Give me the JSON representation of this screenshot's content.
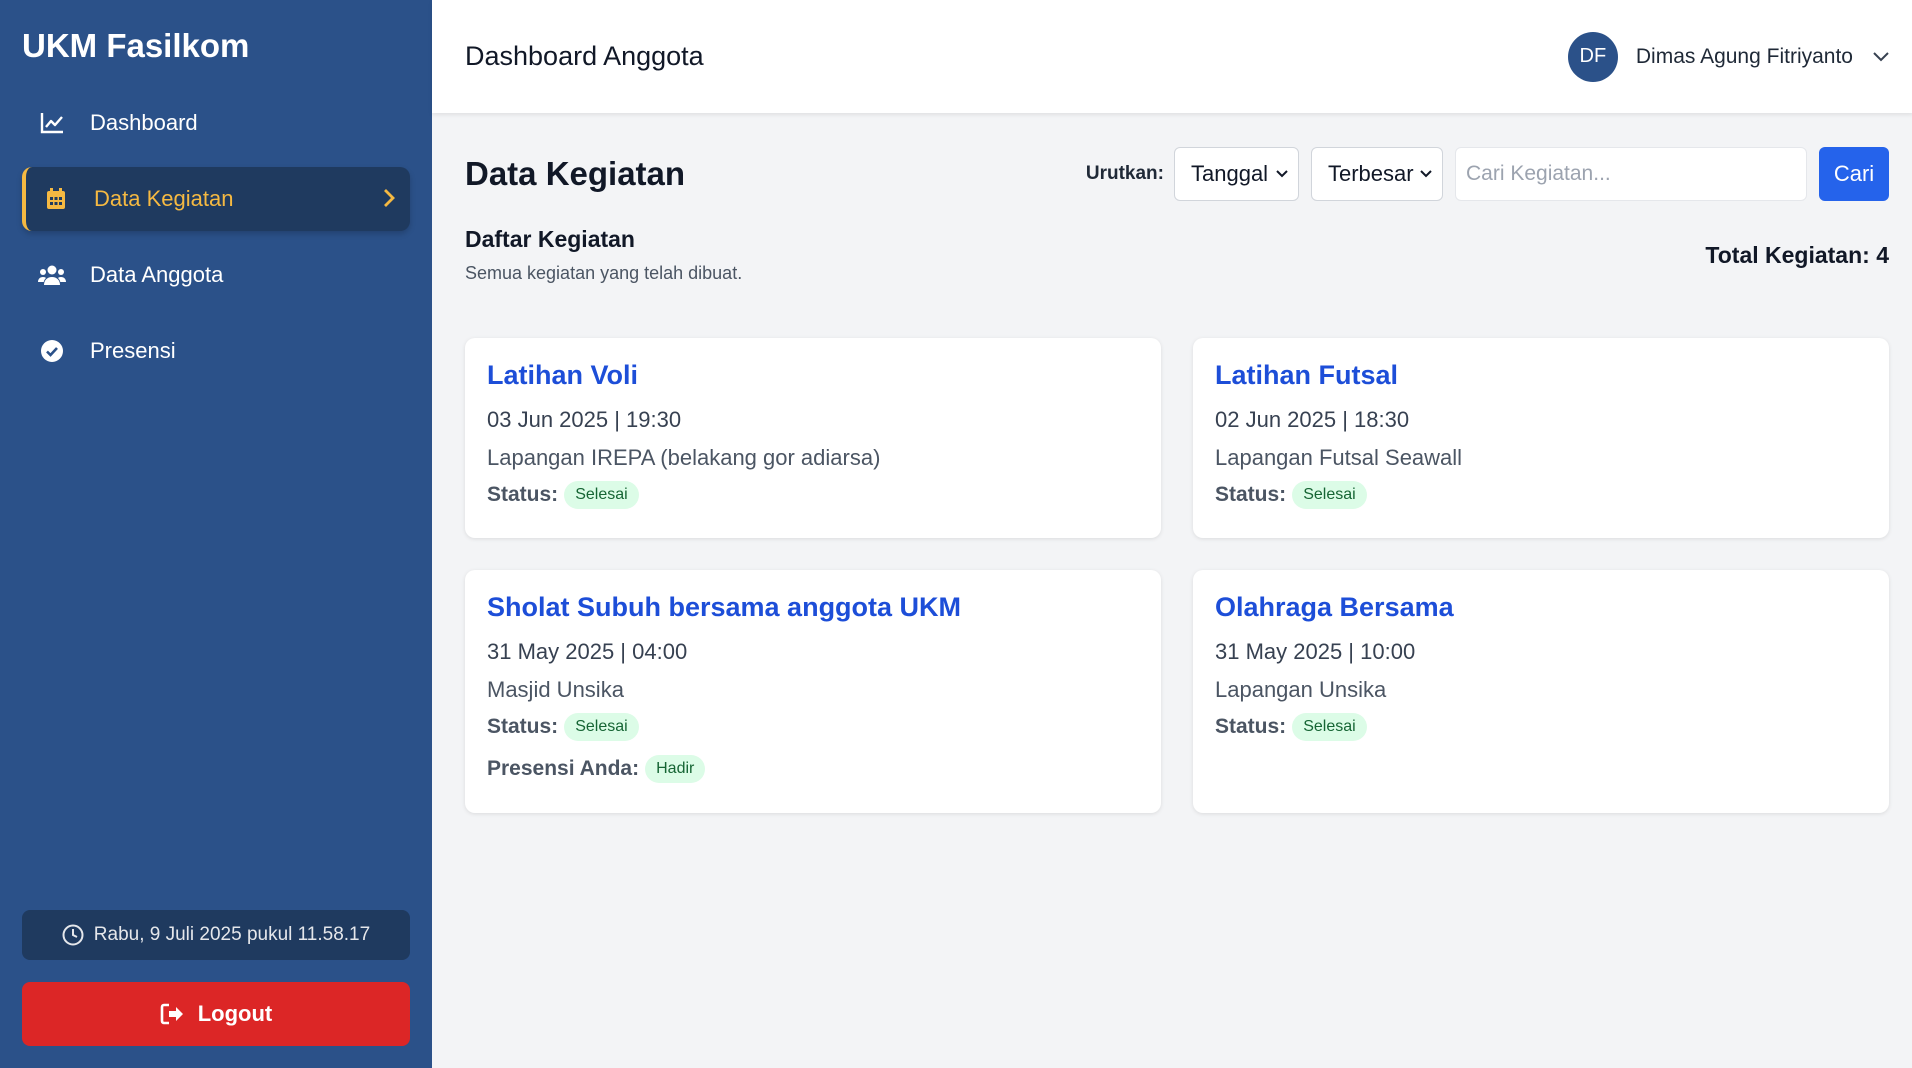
{
  "sidebar": {
    "brand": "UKM Fasilkom",
    "items": [
      {
        "label": "Dashboard",
        "icon": "chart-line-icon"
      },
      {
        "label": "Data Kegiatan",
        "icon": "calendar-icon"
      },
      {
        "label": "Data Anggota",
        "icon": "users-icon"
      },
      {
        "label": "Presensi",
        "icon": "check-circle-icon"
      }
    ],
    "active_index": 1,
    "datetime": "Rabu, 9 Juli 2025 pukul 11.58.17",
    "logout_label": "Logout"
  },
  "header": {
    "title": "Dashboard Anggota",
    "user": {
      "initials": "DF",
      "name": "Dimas Agung Fitriyanto"
    }
  },
  "main": {
    "title": "Data Kegiatan",
    "sort_label": "Urutkan:",
    "sort_field": "Tanggal",
    "sort_order": "Terbesar",
    "search_placeholder": "Cari Kegiatan...",
    "search_button": "Cari",
    "list_title": "Daftar Kegiatan",
    "list_subtitle": "Semua kegiatan yang telah dibuat.",
    "total_label": "Total Kegiatan: 4",
    "status_label": "Status:",
    "presensi_label": "Presensi Anda:",
    "activities": [
      {
        "title": "Latihan Voli",
        "datetime": "03 Jun 2025 | 19:30",
        "location": "Lapangan IREPA (belakang gor adiarsa)",
        "status": "Selesai"
      },
      {
        "title": "Latihan Futsal",
        "datetime": "02 Jun 2025 | 18:30",
        "location": "Lapangan Futsal Seawall",
        "status": "Selesai"
      },
      {
        "title": "Sholat Subuh bersama anggota UKM",
        "datetime": "31 May 2025 | 04:00",
        "location": "Masjid Unsika",
        "status": "Selesai",
        "presensi": "Hadir"
      },
      {
        "title": "Olahraga Bersama",
        "datetime": "31 May 2025 | 10:00",
        "location": "Lapangan Unsika",
        "status": "Selesai"
      }
    ]
  },
  "colors": {
    "sidebar": "#2b5189",
    "active": "#f5b942",
    "primary": "#2563eb",
    "logout": "#dc2626",
    "badge_bg": "#dcfce7",
    "badge_text": "#166534"
  }
}
